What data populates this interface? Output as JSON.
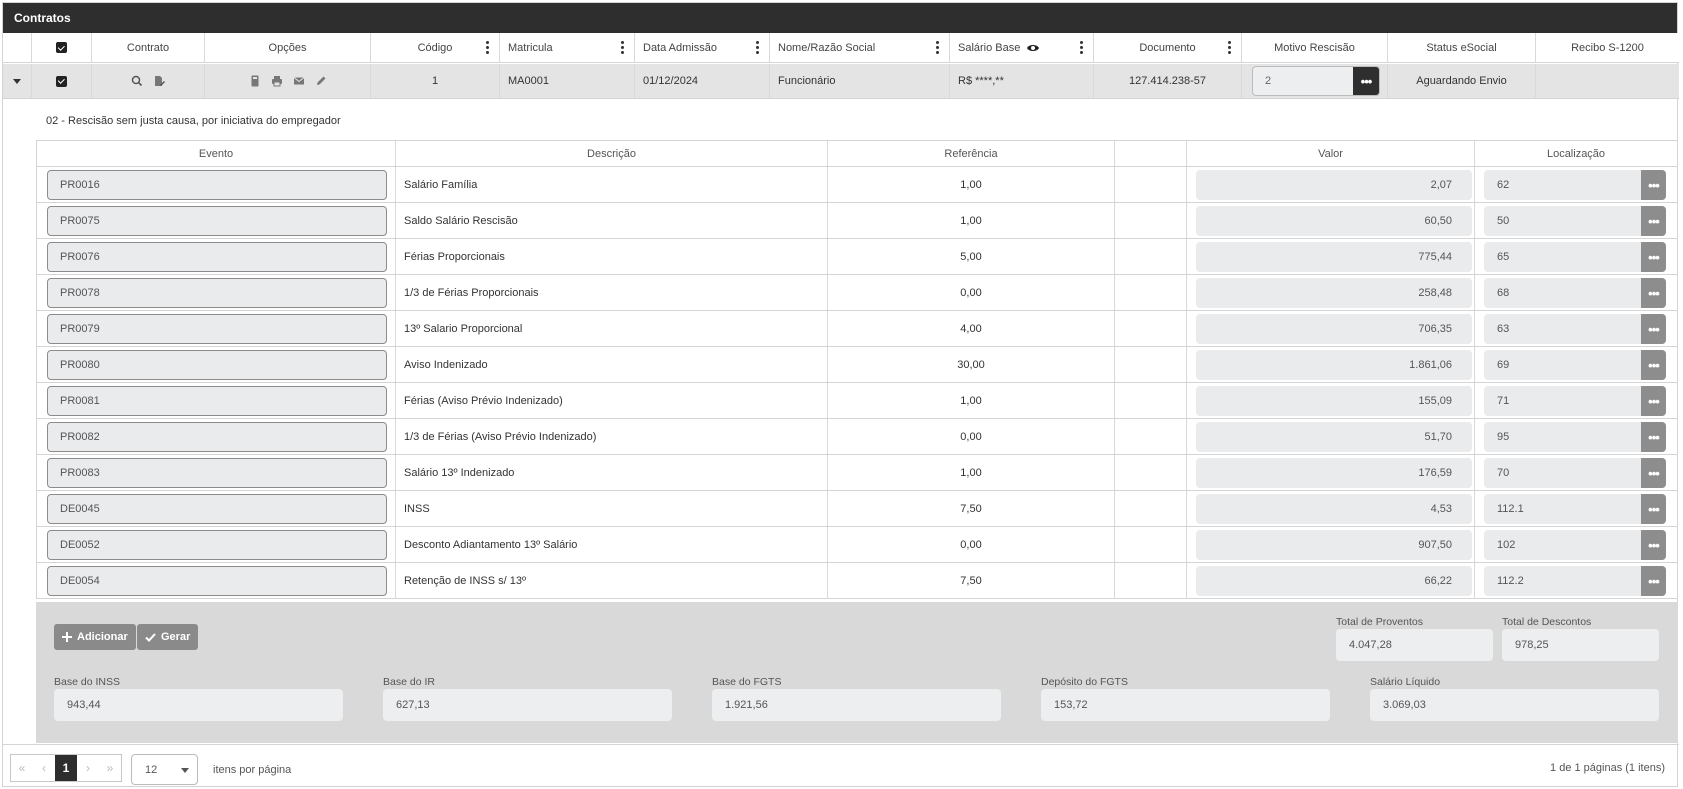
{
  "panel": {
    "title": "Contratos"
  },
  "grid": {
    "headers": {
      "contrato": "Contrato",
      "opcoes": "Opções",
      "codigo": "Código",
      "matricula": "Matricula",
      "data_admissao": "Data Admissão",
      "nome": "Nome/Razão Social",
      "salario_base": "Salário Base",
      "documento": "Documento",
      "motivo_rescisao": "Motivo Rescisão",
      "status_esocial": "Status eSocial",
      "recibo": "Recibo S-1200"
    },
    "row": {
      "codigo": "1",
      "matricula": "MA0001",
      "data_admissao": "01/12/2024",
      "nome": "Funcionário",
      "salario_base": "R$ ****,**",
      "documento": "127.414.238-57",
      "motivo_rescisao": "2",
      "status_esocial": "Aguardando Envio",
      "recibo": ""
    }
  },
  "detail": {
    "motivo_desc": "02 - Rescisão sem justa causa, por iniciativa do empregador",
    "headers": {
      "evento": "Evento",
      "descricao": "Descrição",
      "referencia": "Referência",
      "blank": "",
      "valor": "Valor",
      "localizacao": "Localização"
    },
    "rows": [
      {
        "evento": "PR0016",
        "descricao": "Salário Família",
        "referencia": "1,00",
        "valor": "2,07",
        "localizacao": "62"
      },
      {
        "evento": "PR0075",
        "descricao": "Saldo Salário Rescisão",
        "referencia": "1,00",
        "valor": "60,50",
        "localizacao": "50"
      },
      {
        "evento": "PR0076",
        "descricao": "Férias Proporcionais",
        "referencia": "5,00",
        "valor": "775,44",
        "localizacao": "65"
      },
      {
        "evento": "PR0078",
        "descricao": "1/3 de Férias Proporcionais",
        "referencia": "0,00",
        "valor": "258,48",
        "localizacao": "68"
      },
      {
        "evento": "PR0079",
        "descricao": "13º Salario Proporcional",
        "referencia": "4,00",
        "valor": "706,35",
        "localizacao": "63"
      },
      {
        "evento": "PR0080",
        "descricao": "Aviso Indenizado",
        "referencia": "30,00",
        "valor": "1.861,06",
        "localizacao": "69"
      },
      {
        "evento": "PR0081",
        "descricao": "Férias (Aviso Prévio Indenizado)",
        "referencia": "1,00",
        "valor": "155,09",
        "localizacao": "71"
      },
      {
        "evento": "PR0082",
        "descricao": "1/3 de Férias (Aviso Prévio Indenizado)",
        "referencia": "0,00",
        "valor": "51,70",
        "localizacao": "95"
      },
      {
        "evento": "PR0083",
        "descricao": "Salário 13º Indenizado",
        "referencia": "1,00",
        "valor": "176,59",
        "localizacao": "70"
      },
      {
        "evento": "DE0045",
        "descricao": "INSS",
        "referencia": "7,50",
        "valor": "4,53",
        "localizacao": "112.1"
      },
      {
        "evento": "DE0052",
        "descricao": "Desconto Adiantamento 13º Salário",
        "referencia": "0,00",
        "valor": "907,50",
        "localizacao": "102"
      },
      {
        "evento": "DE0054",
        "descricao": "Retenção de INSS s/ 13º",
        "referencia": "7,50",
        "valor": "66,22",
        "localizacao": "112.2"
      }
    ],
    "buttons": {
      "adicionar": "Adicionar",
      "gerar": "Gerar"
    },
    "totals": {
      "proventos_label": "Total de Proventos",
      "proventos": "4.047,28",
      "descontos_label": "Total de Descontos",
      "descontos": "978,25"
    },
    "bases": {
      "inss_label": "Base do INSS",
      "inss": "943,44",
      "ir_label": "Base do IR",
      "ir": "627,13",
      "fgts_label": "Base do FGTS",
      "fgts": "1.921,56",
      "deposito_label": "Depósito do FGTS",
      "deposito": "153,72",
      "liquido_label": "Salário Líquido",
      "liquido": "3.069,03"
    }
  },
  "pager": {
    "first": "«",
    "prev": "‹",
    "current": "1",
    "next": "›",
    "last": "»",
    "page_size": "12",
    "per_page_label": "itens por página",
    "summary": "1 de 1 páginas (1 itens)"
  },
  "icons": {
    "search": "search-icon",
    "contract_edit": "contract-edit-icon",
    "calculator": "calculator-icon",
    "print": "print-icon",
    "mail": "mail-icon",
    "pencil": "pencil-icon",
    "eye": "eye-icon",
    "plus": "plus-icon",
    "check": "check-icon",
    "caret": "caret-down-icon"
  }
}
